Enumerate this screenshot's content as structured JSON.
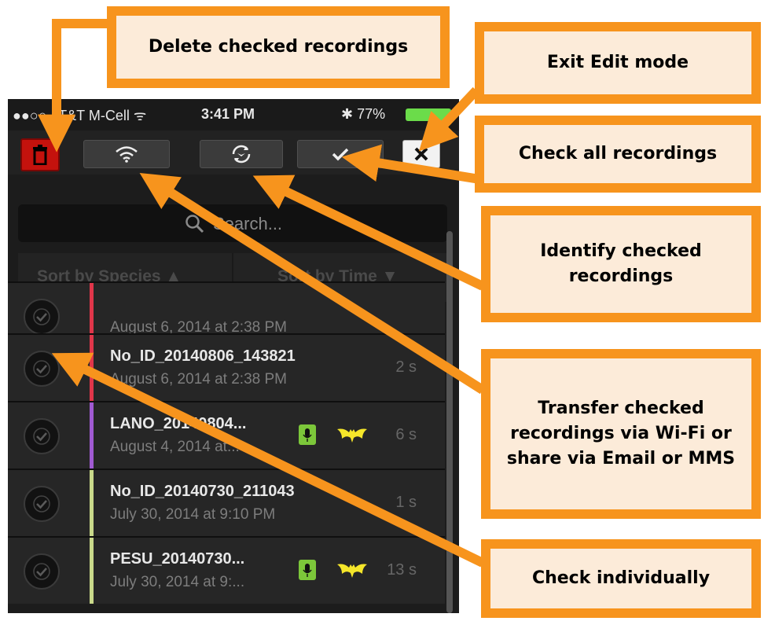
{
  "status_bar": {
    "carrier": "●●○○ AT&T M-Cell ᯤ",
    "time": "3:41 PM",
    "right": "✱ 77%"
  },
  "toolbar": {
    "delete_icon": "trash-icon",
    "wifi_icon": "wifi-icon",
    "identify_icon": "identify-icon",
    "checkall_icon": "checkmark-icon",
    "close_icon": "close-icon"
  },
  "search": {
    "placeholder": "Search..."
  },
  "sort": {
    "by_species": "Sort by Species ▲",
    "by_time": "Sort by Time ▼"
  },
  "recordings": [
    {
      "name": "",
      "date": "August 6, 2014 at 2:38 PM",
      "duration": "",
      "color": "#e0364a",
      "mic": false,
      "bat": false
    },
    {
      "name": "No_ID_20140806_143821",
      "date": "August 6, 2014 at 2:38 PM",
      "duration": "2 s",
      "color": "#e0364a",
      "mic": false,
      "bat": false
    },
    {
      "name": "LANO_20140804...",
      "date": "August 4, 2014 at...",
      "duration": "6 s",
      "color": "#a05ad2",
      "mic": true,
      "bat": true
    },
    {
      "name": "No_ID_20140730_211043",
      "date": "July 30, 2014 at 9:10 PM",
      "duration": "1 s",
      "color": "#c9d98a",
      "mic": false,
      "bat": false
    },
    {
      "name": "PESU_20140730...",
      "date": "July 30, 2014 at 9:...",
      "duration": "13 s",
      "color": "#c9d98a",
      "mic": true,
      "bat": true
    }
  ],
  "callouts": {
    "delete": "Delete checked recordings",
    "exit": "Exit Edit mode",
    "check_all": "Check all recordings",
    "identify": "Identify checked recordings",
    "transfer": "Transfer checked recordings via Wi-Fi or share via Email or MMS",
    "check_individually": "Check individually"
  },
  "colors": {
    "callout_border": "#f7941d",
    "callout_fill": "#fcebd9",
    "arrow": "#f7941d",
    "delete_button": "#c4120d"
  }
}
